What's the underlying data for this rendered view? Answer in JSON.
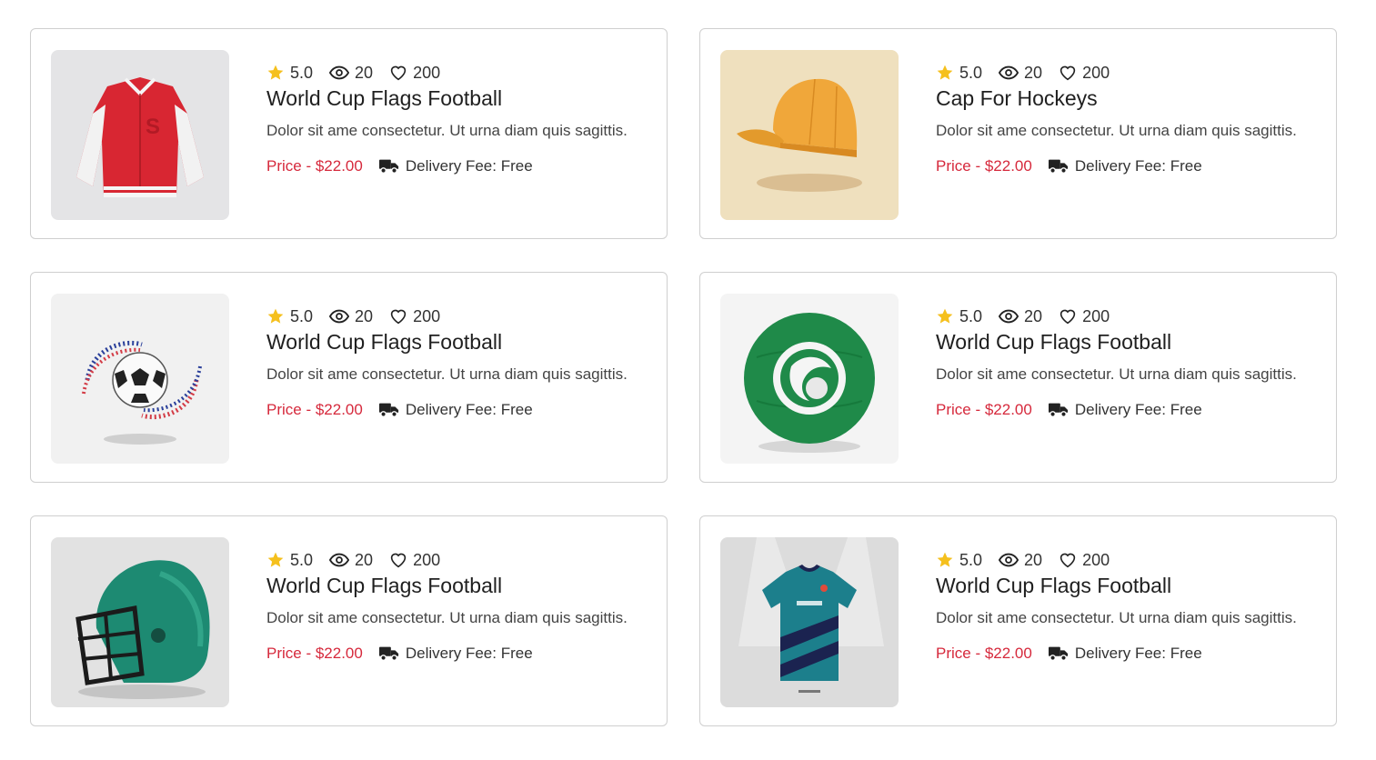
{
  "products": [
    {
      "rating": "5.0",
      "views": "20",
      "likes": "200",
      "title": "World Cup Flags Football",
      "description": "Dolor sit ame consectetur. Ut urna diam quis sagittis.",
      "price": "Price - $22.00",
      "delivery": "Delivery Fee: Free",
      "image": "varsity-jacket"
    },
    {
      "rating": "5.0",
      "views": "20",
      "likes": "200",
      "title": "Cap For Hockeys",
      "description": "Dolor sit ame consectetur. Ut urna diam quis sagittis.",
      "price": "Price - $22.00",
      "delivery": "Delivery Fee: Free",
      "image": "orange-cap"
    },
    {
      "rating": "5.0",
      "views": "20",
      "likes": "200",
      "title": "World Cup Flags Football",
      "description": "Dolor sit ame consectetur. Ut urna diam quis sagittis.",
      "price": "Price - $22.00",
      "delivery": "Delivery Fee: Free",
      "image": "soccer-ball-flag"
    },
    {
      "rating": "5.0",
      "views": "20",
      "likes": "200",
      "title": "World Cup Flags Football",
      "description": "Dolor sit ame consectetur. Ut urna diam quis sagittis.",
      "price": "Price - $22.00",
      "delivery": "Delivery Fee: Free",
      "image": "green-ball"
    },
    {
      "rating": "5.0",
      "views": "20",
      "likes": "200",
      "title": "World Cup Flags Football",
      "description": "Dolor sit ame consectetur. Ut urna diam quis sagittis.",
      "price": "Price - $22.00",
      "delivery": "Delivery Fee: Free",
      "image": "football-helmet"
    },
    {
      "rating": "5.0",
      "views": "20",
      "likes": "200",
      "title": "World Cup Flags Football",
      "description": "Dolor sit ame consectetur. Ut urna diam quis sagittis.",
      "price": "Price - $22.00",
      "delivery": "Delivery Fee: Free",
      "image": "teal-jersey"
    }
  ],
  "colors": {
    "price": "#d6293c",
    "star": "#f5c01d",
    "border": "#cfcfcf"
  }
}
